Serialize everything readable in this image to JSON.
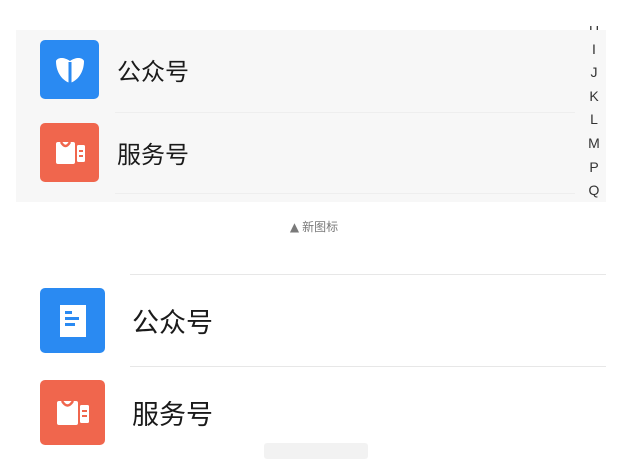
{
  "top_section": {
    "rows": [
      {
        "label": "公众号",
        "icon": "public-account-leaf-icon",
        "color": "#2a8af2"
      },
      {
        "label": "服务号",
        "icon": "service-account-bag-icon",
        "color": "#f0664d"
      }
    ],
    "index_letters": [
      "H",
      "I",
      "J",
      "K",
      "L",
      "M",
      "P",
      "Q"
    ]
  },
  "caption": {
    "marker": "▲",
    "text": "新图标"
  },
  "bottom_section": {
    "rows": [
      {
        "label": "公众号",
        "icon": "public-account-document-icon",
        "color": "#2a8af2"
      },
      {
        "label": "服务号",
        "icon": "service-account-bag-icon",
        "color": "#f0664d"
      }
    ]
  }
}
